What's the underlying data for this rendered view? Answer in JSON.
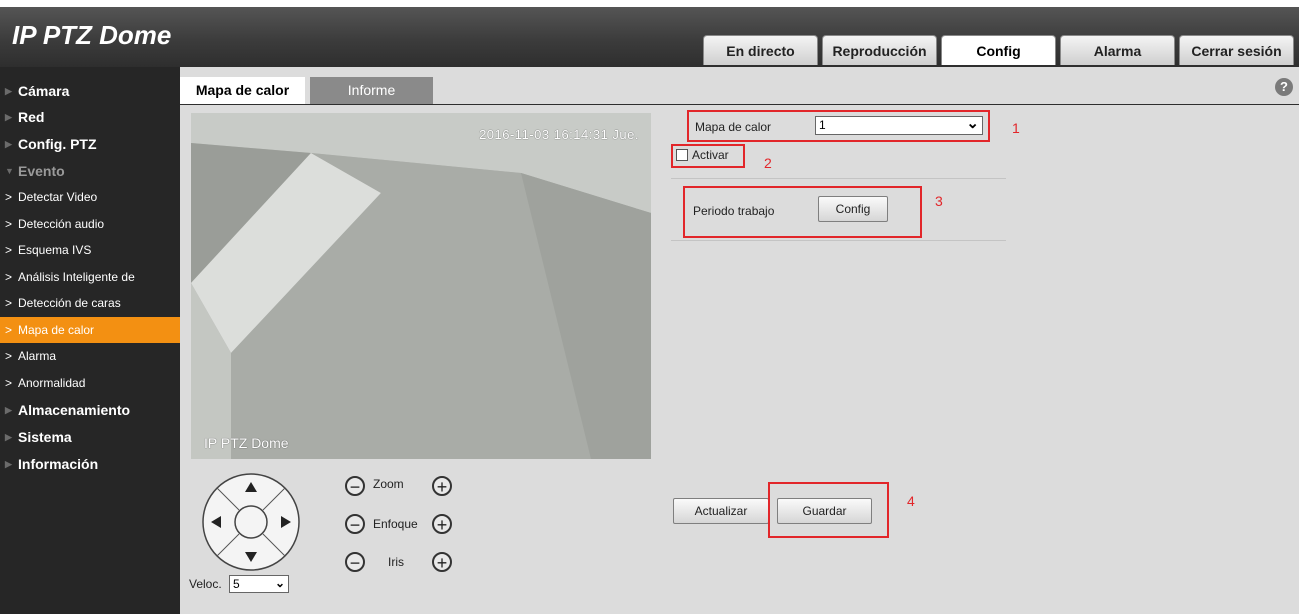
{
  "app": {
    "title": "IP PTZ Dome"
  },
  "nav": {
    "tabs": [
      {
        "label": "En directo",
        "active": false
      },
      {
        "label": "Reproducción",
        "active": false
      },
      {
        "label": "Config",
        "active": true
      },
      {
        "label": "Alarma",
        "active": false
      },
      {
        "label": "Cerrar sesión",
        "active": false
      }
    ]
  },
  "sidebar": {
    "items": [
      {
        "label": "Cámara"
      },
      {
        "label": "Red"
      },
      {
        "label": "Config. PTZ"
      },
      {
        "label": "Evento",
        "expanded": true
      },
      {
        "label": "Almacenamiento"
      },
      {
        "label": "Sistema"
      },
      {
        "label": "Información"
      }
    ],
    "evento_subitems": [
      {
        "label": "Detectar Video"
      },
      {
        "label": "Detección audio"
      },
      {
        "label": "Esquema IVS"
      },
      {
        "label": "Análisis Inteligente de"
      },
      {
        "label": "Detección de caras"
      },
      {
        "label": "Mapa de calor",
        "active": true
      },
      {
        "label": "Alarma"
      },
      {
        "label": "Anormalidad"
      }
    ],
    "accent_color": "#f39012"
  },
  "content": {
    "tabs": [
      {
        "label": "Mapa de calor",
        "active": true
      },
      {
        "label": "Informe",
        "active": false
      }
    ],
    "help_icon": "?"
  },
  "video": {
    "timestamp": "2016-11-03 16:14:31 Jue.",
    "camera_name": "IP PTZ Dome"
  },
  "ptz": {
    "zoom_label": "Zoom",
    "focus_label": "Enfoque",
    "iris_label": "Iris",
    "minus_symbol": "−",
    "plus_symbol": "+",
    "speed_label": "Veloc.",
    "speed_value": "5"
  },
  "form": {
    "heatmap_label": "Mapa de calor",
    "heatmap_value": "1",
    "enable_label": "Activar",
    "enable_checked": false,
    "schedule_label": "Periodo trabajo",
    "schedule_button": "Config",
    "refresh_button": "Actualizar",
    "save_button": "Guardar"
  },
  "annotations": [
    "1",
    "2",
    "3",
    "4"
  ]
}
